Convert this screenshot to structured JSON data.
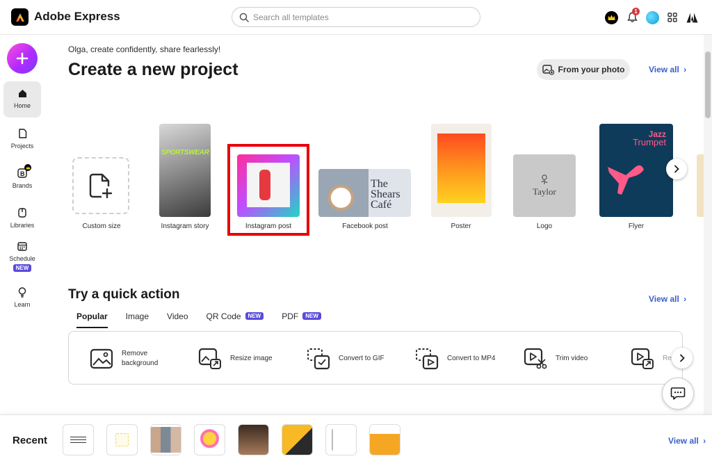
{
  "app": {
    "title": "Adobe Express"
  },
  "search": {
    "placeholder": "Search all templates"
  },
  "header": {
    "notification_count": "1"
  },
  "sidebar": {
    "items": [
      {
        "label": "Home"
      },
      {
        "label": "Projects"
      },
      {
        "label": "Brands"
      },
      {
        "label": "Libraries"
      },
      {
        "label": "Schedule",
        "badge": "NEW"
      },
      {
        "label": "Learn"
      }
    ]
  },
  "main": {
    "greeting": "Olga, create confidently, share fearlessly!",
    "title": "Create a new project",
    "from_photo_label": "From your photo",
    "view_all_label": "View all",
    "templates": [
      {
        "label": "Custom size"
      },
      {
        "label": "Instagram story",
        "thumb_text": "SPORTSWEAR"
      },
      {
        "label": "Instagram post"
      },
      {
        "label": "Facebook post",
        "thumb_text": "The Shears Café"
      },
      {
        "label": "Poster"
      },
      {
        "label": "Logo",
        "thumb_text": "Taylor"
      },
      {
        "label": "Flyer",
        "thumb_text_1": "Jazz",
        "thumb_text_2": "Trumpet"
      }
    ]
  },
  "quick_actions": {
    "title": "Try a quick action",
    "view_all_label": "View all",
    "tabs": [
      {
        "label": "Popular",
        "active": true
      },
      {
        "label": "Image"
      },
      {
        "label": "Video"
      },
      {
        "label": "QR Code",
        "badge": "NEW"
      },
      {
        "label": "PDF",
        "badge": "NEW"
      }
    ],
    "actions": [
      {
        "label_1": "Remove",
        "label_2": "background",
        "icon": "remove-background-icon"
      },
      {
        "label": "Resize image",
        "icon": "resize-image-icon"
      },
      {
        "label": "Convert to GIF",
        "icon": "convert-gif-icon"
      },
      {
        "label": "Convert to MP4",
        "icon": "convert-mp4-icon"
      },
      {
        "label": "Trim video",
        "icon": "trim-video-icon"
      },
      {
        "label": "Re",
        "icon": "resize-video-icon"
      }
    ]
  },
  "recent": {
    "title": "Recent",
    "view_all_label": "View all"
  },
  "colors": {
    "accent_link": "#3a5fcd",
    "new_badge": "#5b4bdb",
    "highlight": "#e8000b"
  }
}
